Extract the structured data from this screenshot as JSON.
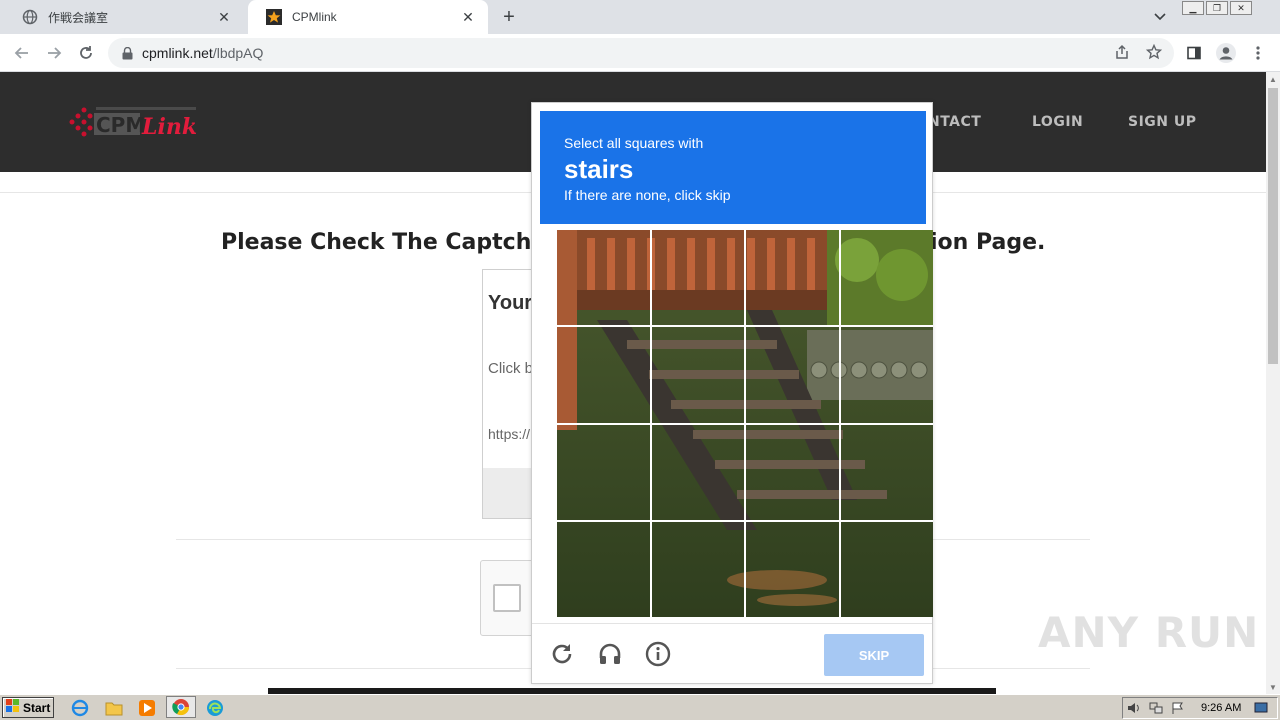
{
  "browser": {
    "tabs": [
      {
        "title": "作戦会議室",
        "active": false
      },
      {
        "title": "CPMlink",
        "active": true
      }
    ],
    "url_host": "cpmlink.net",
    "url_path": "/lbdpAQ"
  },
  "site": {
    "nav": [
      "NTACT",
      "LOGIN",
      "SIGN UP"
    ],
    "headline_left": "Please Check The Captcha",
    "headline_right": "ion Page.",
    "box_title": "Your",
    "box_click": "Click b",
    "box_url": "https://"
  },
  "captcha": {
    "line1": "Select all squares with",
    "keyword": "stairs",
    "line3": "If there are none, click skip",
    "skip_label": "SKIP",
    "accent_color": "#1a73e8",
    "icons": [
      "reload-icon",
      "headphones-icon",
      "info-icon"
    ]
  },
  "watermark": "ANY RUN",
  "taskbar": {
    "start_label": "Start",
    "clock": "9:26 AM"
  }
}
